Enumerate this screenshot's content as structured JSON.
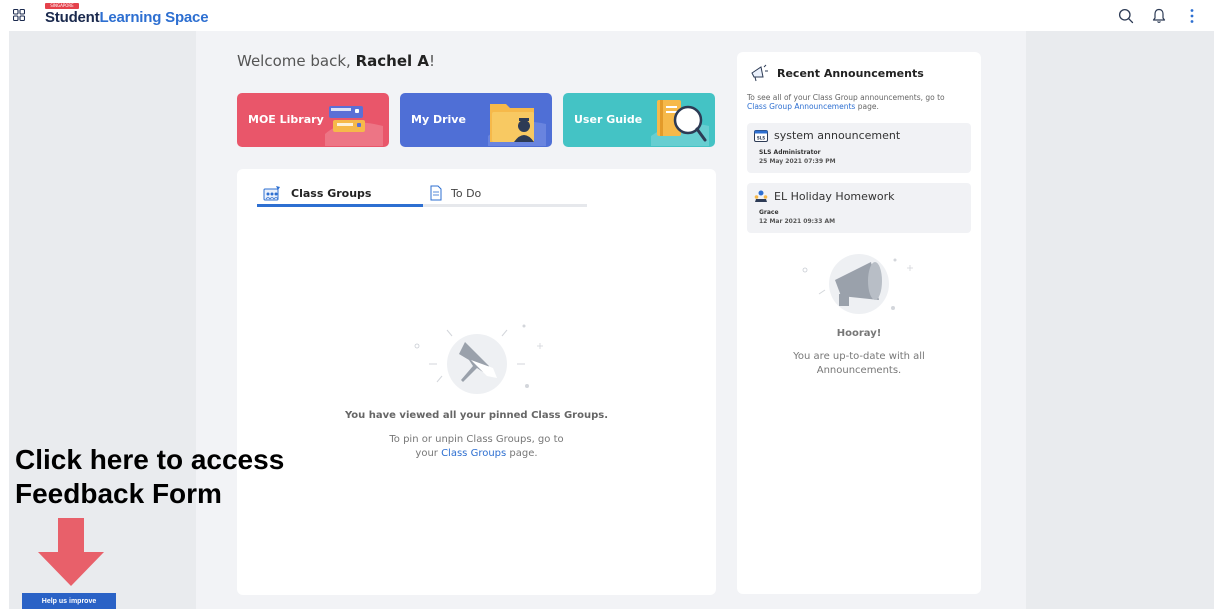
{
  "topbar": {
    "logo_tag": "SINGAPORE",
    "logo_student": "Student",
    "logo_learning_space": "Learning Space",
    "icons": [
      "apps-grid-icon",
      "search-icon",
      "bell-icon",
      "more-vert-icon"
    ]
  },
  "welcome": {
    "prefix": "Welcome back, ",
    "name": "Rachel A",
    "suffix": "!"
  },
  "tiles": [
    {
      "label": "MOE Library",
      "color": "#e9566a"
    },
    {
      "label": "My Drive",
      "color": "#4f6fd6"
    },
    {
      "label": "User Guide",
      "color": "#44c3c5"
    }
  ],
  "tabs": {
    "class_groups": "Class Groups",
    "todo": "To Do"
  },
  "empty_state": {
    "title": "You have viewed all your pinned Class Groups.",
    "line1": "To pin or unpin Class Groups, go to",
    "line2_prefix": "your ",
    "line2_link": "Class Groups",
    "line2_suffix": " page."
  },
  "announcements": {
    "title": "Recent Announcements",
    "intro_prefix": "To see all of your Class Group announcements, go to",
    "intro_link": "Class Group Announcements",
    "intro_suffix": " page.",
    "items": [
      {
        "title": "system announcement",
        "author": "SLS Administrator",
        "date": "25 May 2021 07:39 PM",
        "icon": "sls-icon"
      },
      {
        "title": "EL Holiday Homework",
        "author": "Grace",
        "date": "12 Mar 2021 09:33 AM",
        "icon": "class-group-icon"
      }
    ],
    "hooray": "Hooray!",
    "uptodate_line1": "You are up-to-date with all",
    "uptodate_line2": "Announcements."
  },
  "callout": {
    "line1": "Click here to access",
    "line2": "Feedback Form",
    "arrow_color": "#e8606a"
  },
  "help_button": "Help us improve",
  "colors": {
    "accent": "#2d6fd1",
    "panel_bg": "#f2f3f6"
  }
}
